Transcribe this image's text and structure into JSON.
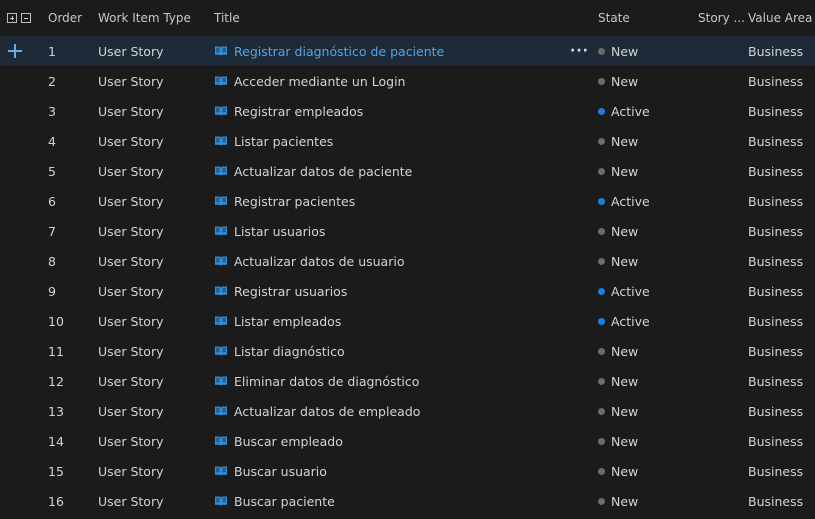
{
  "columns": {
    "order": "Order",
    "type": "Work Item Type",
    "title": "Title",
    "state": "State",
    "story_points": "Story ...",
    "value_area": "Value Area"
  },
  "colors": {
    "state_new": "#6c6c6c",
    "state_active": "#1e7fd8",
    "link": "#4ea6ea"
  },
  "rows": [
    {
      "order": "1",
      "type": "User Story",
      "title": "Registrar diagnóstico de paciente",
      "state": "New",
      "area": "Business",
      "selected": true
    },
    {
      "order": "2",
      "type": "User Story",
      "title": "Acceder mediante un Login",
      "state": "New",
      "area": "Business"
    },
    {
      "order": "3",
      "type": "User Story",
      "title": "Registrar empleados",
      "state": "Active",
      "area": "Business"
    },
    {
      "order": "4",
      "type": "User Story",
      "title": "Listar pacientes",
      "state": "New",
      "area": "Business"
    },
    {
      "order": "5",
      "type": "User Story",
      "title": "Actualizar datos de paciente",
      "state": "New",
      "area": "Business"
    },
    {
      "order": "6",
      "type": "User Story",
      "title": "Registrar pacientes",
      "state": "Active",
      "area": "Business"
    },
    {
      "order": "7",
      "type": "User Story",
      "title": "Listar usuarios",
      "state": "New",
      "area": "Business"
    },
    {
      "order": "8",
      "type": "User Story",
      "title": "Actualizar datos de usuario",
      "state": "New",
      "area": "Business"
    },
    {
      "order": "9",
      "type": "User Story",
      "title": "Registrar usuarios",
      "state": "Active",
      "area": "Business"
    },
    {
      "order": "10",
      "type": "User Story",
      "title": "Listar empleados",
      "state": "Active",
      "area": "Business"
    },
    {
      "order": "11",
      "type": "User Story",
      "title": "Listar diagnóstico",
      "state": "New",
      "area": "Business"
    },
    {
      "order": "12",
      "type": "User Story",
      "title": "Eliminar datos de diagnóstico",
      "state": "New",
      "area": "Business"
    },
    {
      "order": "13",
      "type": "User Story",
      "title": "Actualizar datos de empleado",
      "state": "New",
      "area": "Business"
    },
    {
      "order": "14",
      "type": "User Story",
      "title": "Buscar empleado",
      "state": "New",
      "area": "Business"
    },
    {
      "order": "15",
      "type": "User Story",
      "title": "Buscar usuario",
      "state": "New",
      "area": "Business"
    },
    {
      "order": "16",
      "type": "User Story",
      "title": "Buscar paciente",
      "state": "New",
      "area": "Business"
    }
  ]
}
